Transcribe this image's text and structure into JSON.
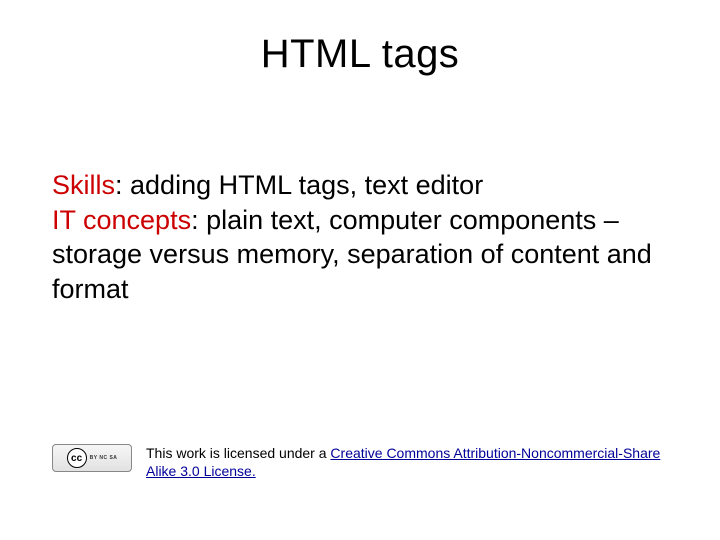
{
  "title": "HTML tags",
  "body": {
    "skills_label": "Skills",
    "skills_text": ":  adding HTML tags, text editor",
    "concepts_label": "IT concepts",
    "concepts_text": ":  plain text, computer components – storage versus memory, separation of content and format"
  },
  "footer": {
    "cc_mark": "cc",
    "cc_sub": "BY   NC   SA",
    "prefix": "This work is licensed under a ",
    "link_text": "Creative Commons Attribution-Noncommercial-Share Alike 3.0 License."
  }
}
